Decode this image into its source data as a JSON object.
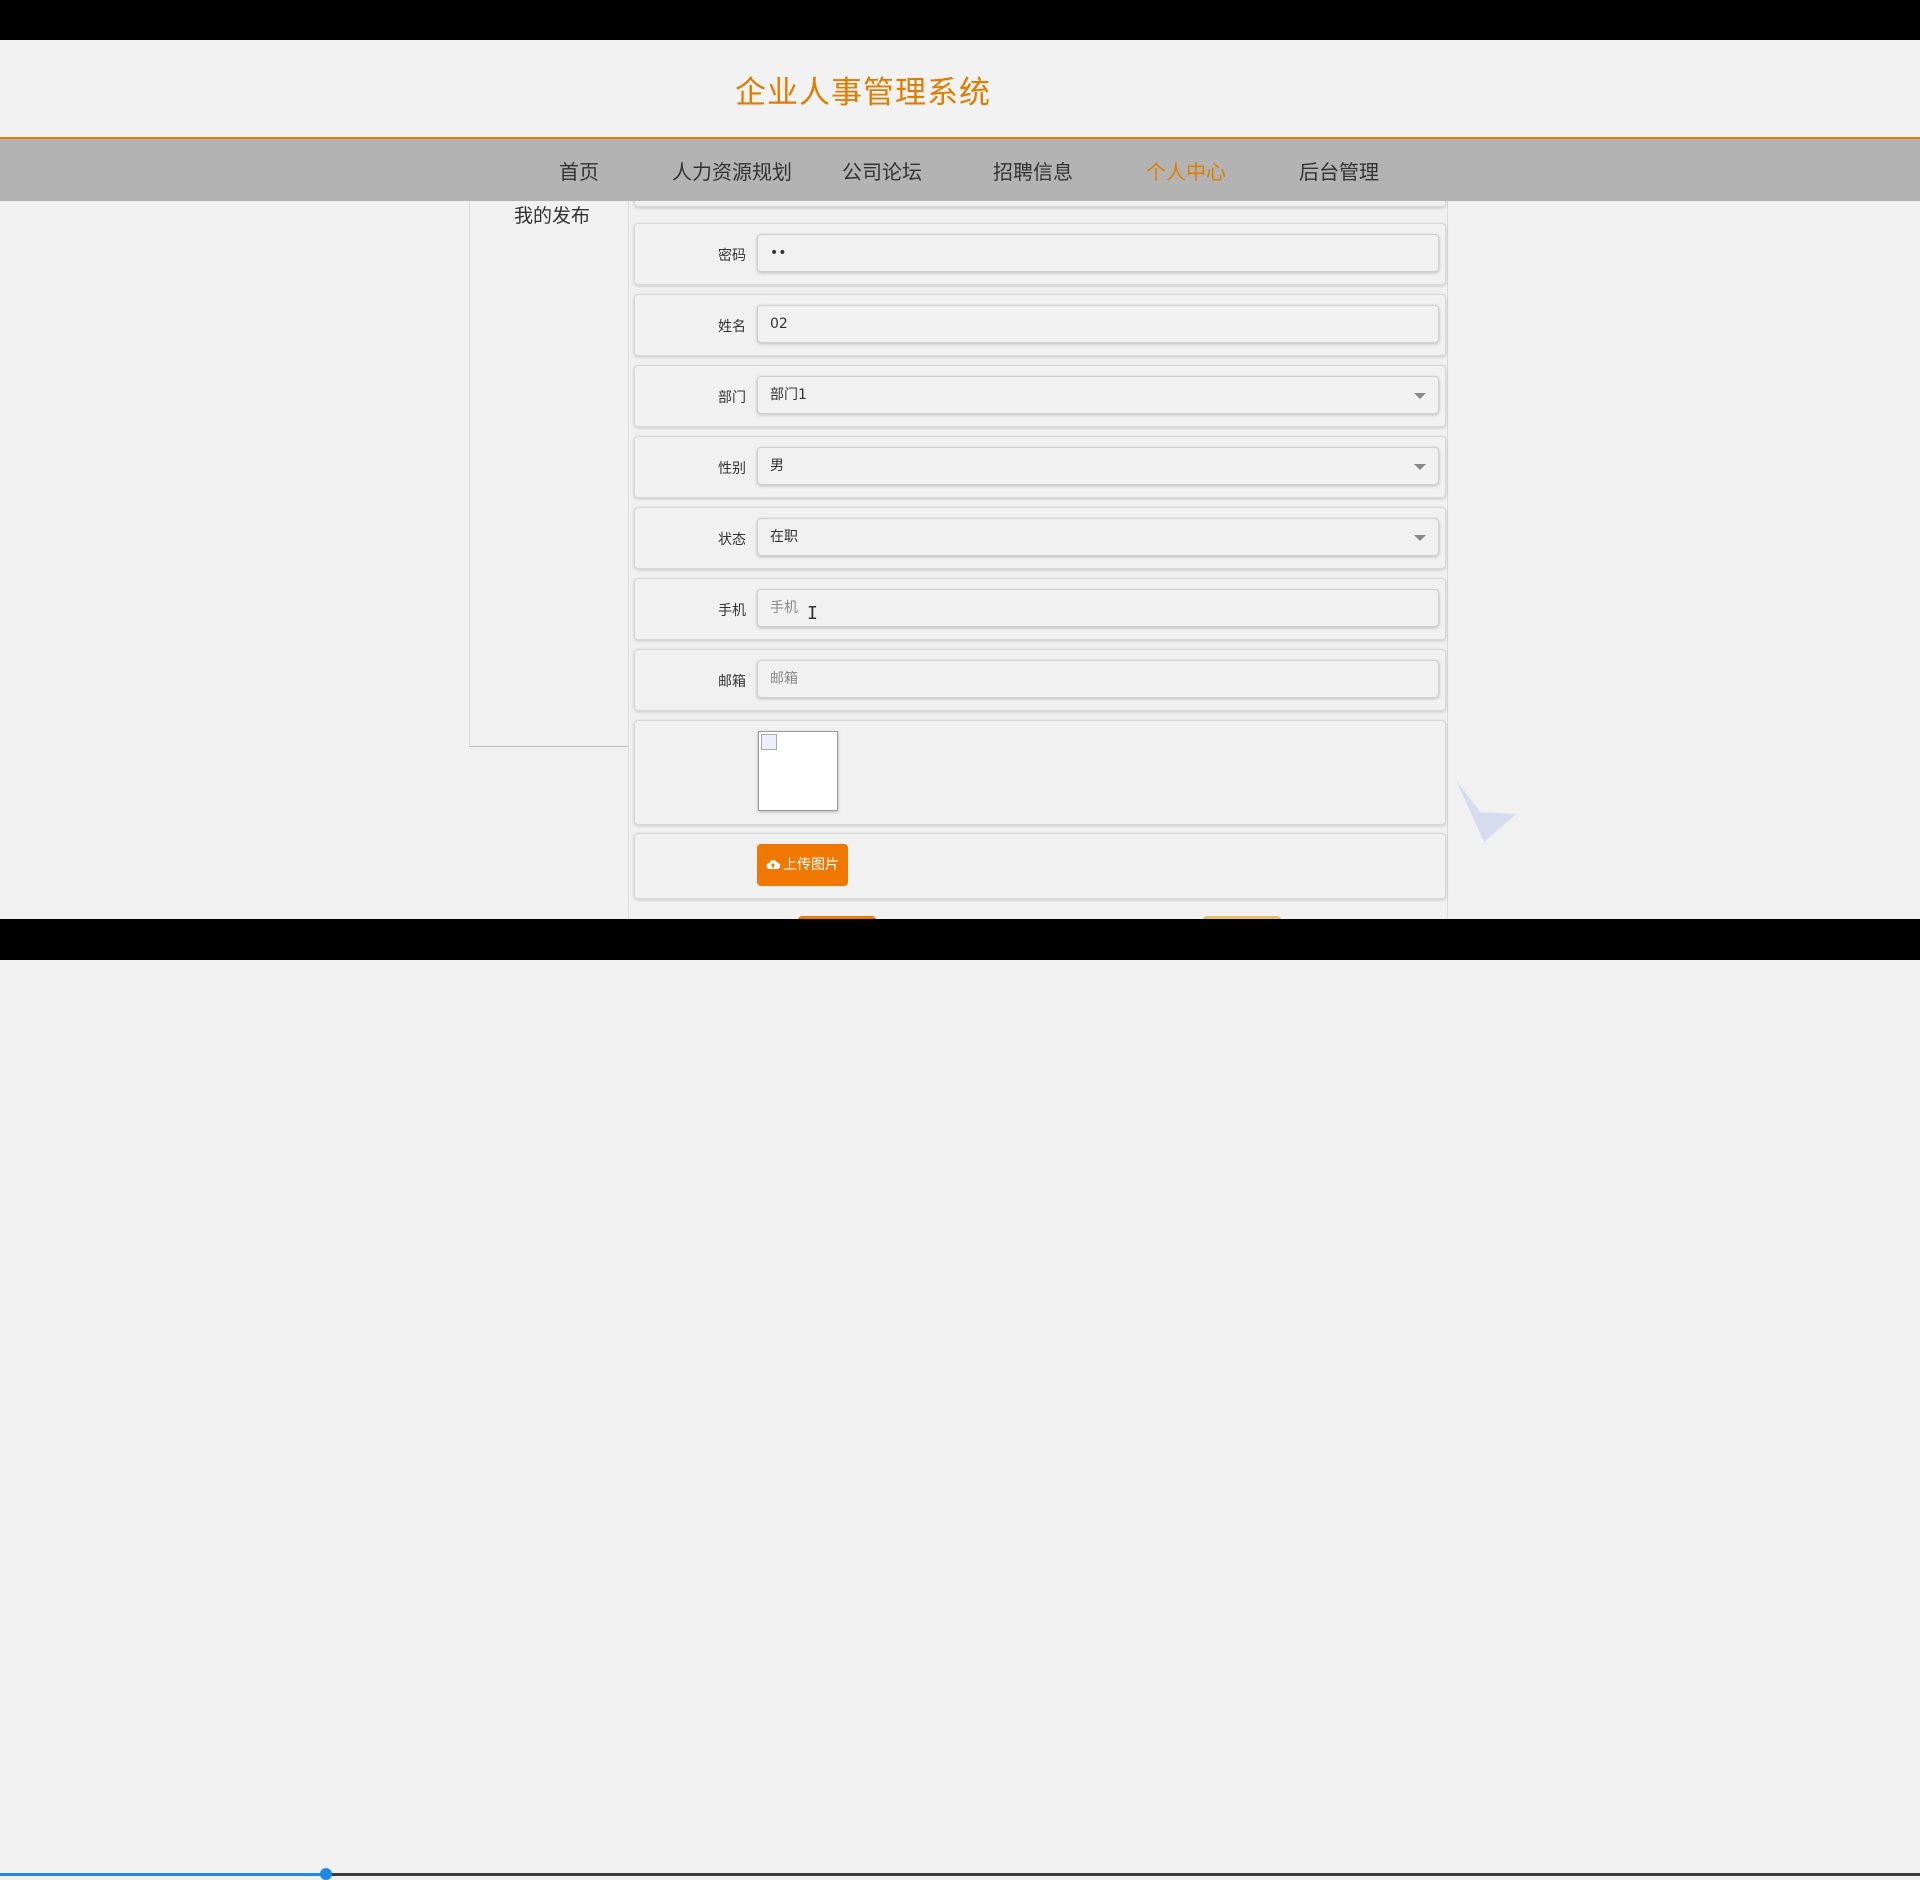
{
  "site": {
    "title": "企业人事管理系统"
  },
  "nav": {
    "items": [
      {
        "label": "首页",
        "active": false
      },
      {
        "label": "人力资源规划",
        "active": false
      },
      {
        "label": "公司论坛",
        "active": false
      },
      {
        "label": "招聘信息",
        "active": false
      },
      {
        "label": "个人中心",
        "active": true
      },
      {
        "label": "后台管理",
        "active": false
      }
    ]
  },
  "sidebar": {
    "items": [
      {
        "label": "我的发布"
      }
    ]
  },
  "form": {
    "password": {
      "label": "密码",
      "value": "••"
    },
    "name": {
      "label": "姓名",
      "value": "02"
    },
    "department": {
      "label": "部门",
      "value": "部门1"
    },
    "gender": {
      "label": "性别",
      "value": "男"
    },
    "status": {
      "label": "状态",
      "value": "在职"
    },
    "phone": {
      "label": "手机",
      "value": "",
      "placeholder": "手机"
    },
    "email": {
      "label": "邮箱",
      "value": "",
      "placeholder": "邮箱"
    },
    "upload_label": "上传图片"
  },
  "video_progress": 0.17,
  "colors": {
    "accent": "#e07c00",
    "nav_bg": "#b3b3b3",
    "button": "#f07800",
    "progress": "#1e88e5"
  },
  "icons": {
    "upload": "cloud-upload-icon",
    "select": "chevron-down-icon",
    "cursor": "text-cursor-icon"
  }
}
